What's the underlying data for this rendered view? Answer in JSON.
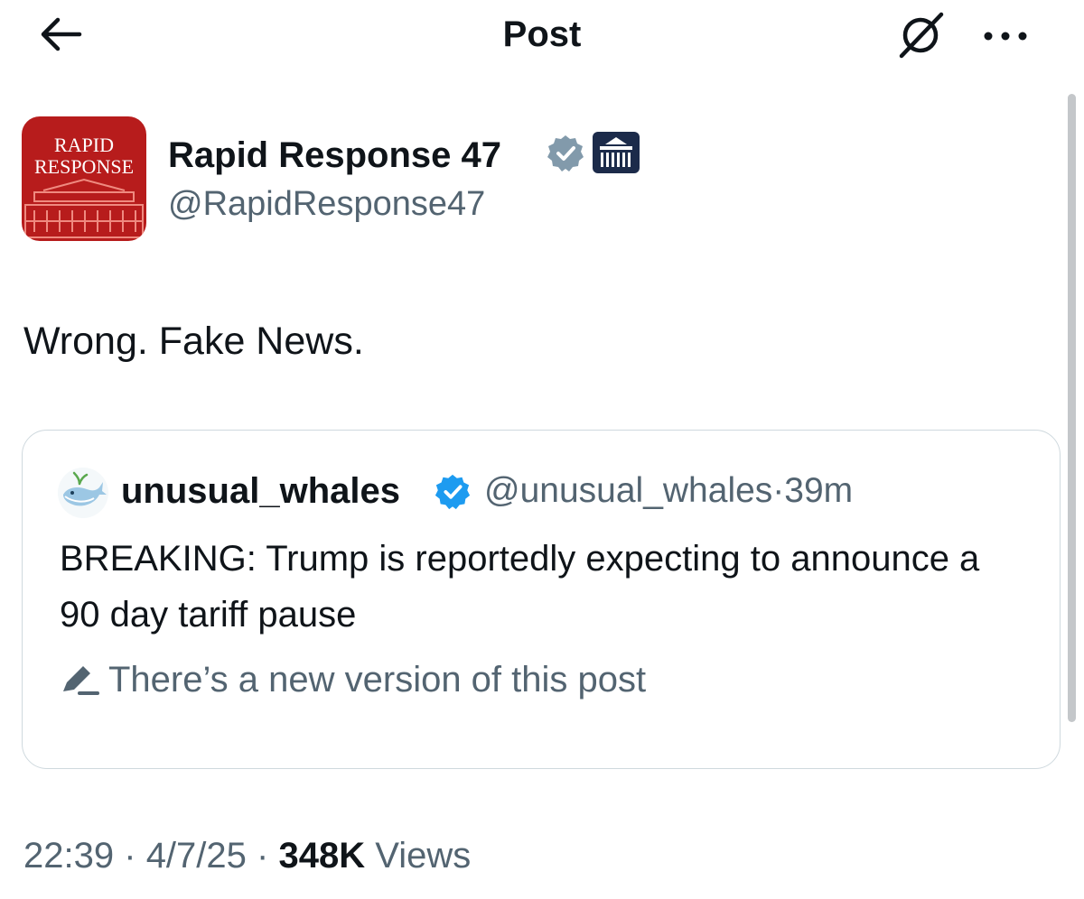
{
  "header": {
    "title": "Post",
    "back_icon": "arrow-left-icon",
    "grok_icon": "grok-icon",
    "more_icon": "more-horizontal-icon"
  },
  "author": {
    "display_name": "Rapid Response 47",
    "handle": "@RapidResponse47",
    "avatar_wordmark_line1": "RAPID",
    "avatar_wordmark_line2": "RESPONSE",
    "verified_badge_color": "#829aab",
    "avatar_color": "#b71c1c"
  },
  "post": {
    "text": "Wrong. Fake News.",
    "time": "22:39",
    "date": "4/7/25",
    "views_count": "348K",
    "views_label": "Views",
    "separator": "·"
  },
  "quoted_post": {
    "display_name": "unusual_whales",
    "handle": "@unusual_whales",
    "age": "39m",
    "text": "BREAKING: Trump is reportedly expecting to announce a 90 day tariff pause",
    "edit_notice": "There’s a new version of this post",
    "verified_badge_color": "#1d9bf0"
  },
  "colors": {
    "text_primary": "#0f1419",
    "text_secondary": "#536471",
    "border": "#cfd9de"
  }
}
